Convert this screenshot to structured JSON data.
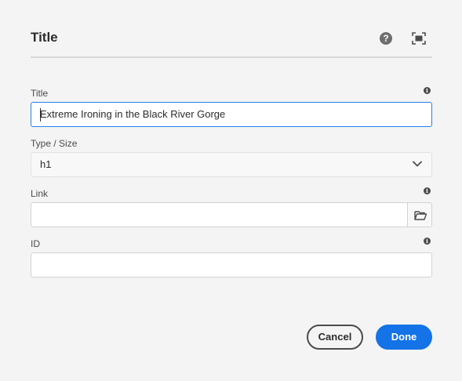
{
  "dialog": {
    "title": "Title",
    "help_icon": "question-circle-icon",
    "fullscreen_icon": "fullscreen-icon"
  },
  "fields": {
    "title": {
      "label": "Title",
      "value": "Extreme Ironing in the Black River Gorge",
      "info_icon": "info-icon"
    },
    "type_size": {
      "label": "Type / Size",
      "selected": "h1",
      "icon": "chevron-down-icon"
    },
    "link": {
      "label": "Link",
      "value": "",
      "info_icon": "info-icon",
      "browse_icon": "folder-open-icon"
    },
    "id": {
      "label": "ID",
      "value": "",
      "info_icon": "info-icon"
    }
  },
  "footer": {
    "cancel_label": "Cancel",
    "done_label": "Done"
  },
  "colors": {
    "accent": "#1473e6",
    "focus": "#2680eb",
    "background": "#f4f4f4"
  }
}
